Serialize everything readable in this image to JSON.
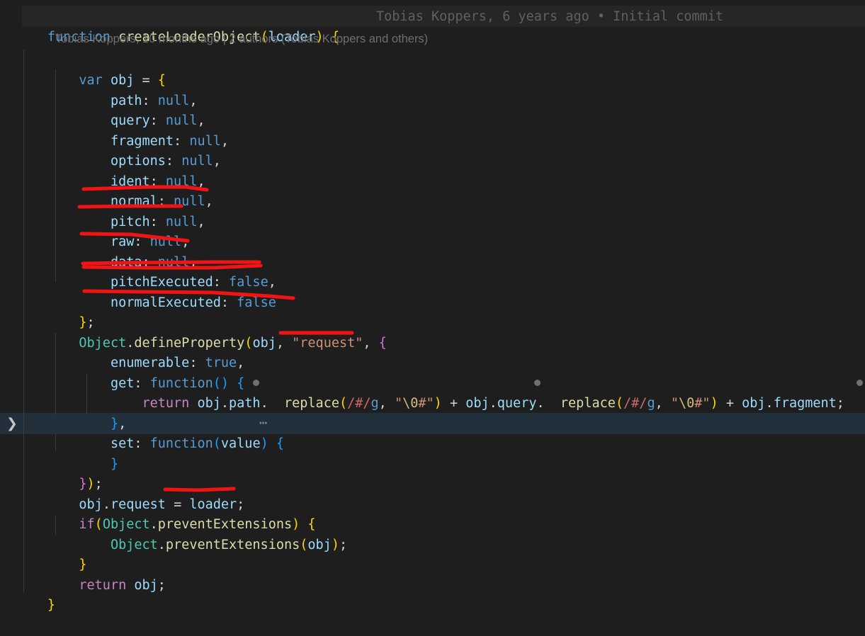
{
  "app": {
    "kind": "code-editor",
    "theme": "dark-plus",
    "background": "#1e1e1e",
    "annotation_color": "#f21414",
    "current_line_highlight": "#22303c"
  },
  "blame": {
    "inline_current_line": "Tobias Koppers, 6 years ago • Initial commit",
    "heatmap_row": "Tobias Koppers, 10 months ago | 2 authors (Tobias Koppers and others)"
  },
  "gutter": {
    "fold_chevron": "❯",
    "folded_placeholder": "⋯"
  },
  "code": {
    "language": "javascript",
    "lines": [
      "function createLoaderObject(loader) {",
      "",
      "    var obj = {",
      "        path: null,",
      "        query: null,",
      "        fragment: null,",
      "        options: null,",
      "        ident: null,",
      "        normal: null,",
      "        pitch: null,",
      "        raw: null,",
      "        data: null,",
      "        pitchExecuted: false,",
      "        normalExecuted: false",
      "    };",
      "    Object.defineProperty(obj, \"request\", {",
      "        enumerable: true,",
      "        get: function() {",
      "            return obj.path. replace(/#/g, \"\\0#\") + obj.query. replace(/#/g, \"\\0#\") + obj.fragment;",
      "        },",
      "        set: function(value) {⋯",
      "        }",
      "    });",
      "    obj.request = loader;",
      "    if(Object.preventExtensions) {",
      "        Object.preventExtensions(obj);",
      "    }",
      "    return obj;",
      "}"
    ]
  },
  "annotations": {
    "underlines": [
      {
        "target": "normal: null,",
        "note": "red underline stroke"
      },
      {
        "target": "pitch: null,",
        "note": "red underline stroke"
      },
      {
        "target": "raw: null,",
        "note": "red underline stroke"
      },
      {
        "target": "data: null,",
        "note": "red strikethrough stroke"
      },
      {
        "target": "pitchExecuted: false,",
        "note": "red underline stroke"
      },
      {
        "target": "normalExecuted: false",
        "note": "red underline stroke"
      },
      {
        "target": "\"request\"",
        "note": "red underline stroke"
      },
      {
        "target": "loader;",
        "note": "red underline stroke"
      }
    ]
  }
}
